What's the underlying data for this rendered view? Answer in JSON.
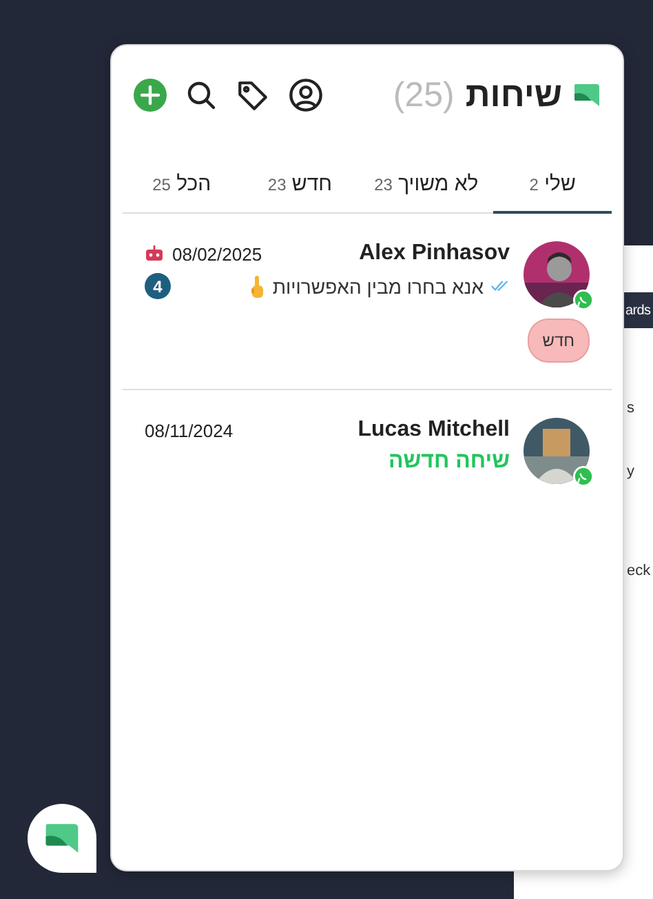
{
  "background_page": {
    "fragments": [
      "ards",
      "s",
      "y",
      "eck"
    ]
  },
  "header": {
    "title": "שיחות",
    "count": "(25)"
  },
  "tabs": [
    {
      "label": "שלי",
      "count": "2",
      "selected": true
    },
    {
      "label": "לא משויך",
      "count": "23",
      "selected": false
    },
    {
      "label": "חדש",
      "count": "23",
      "selected": false
    },
    {
      "label": "הכל",
      "count": "25",
      "selected": false
    }
  ],
  "conversations": [
    {
      "name": "Alex Pinhasov",
      "date": "08/02/2025",
      "bot": true,
      "kind": "message",
      "preview": "אנא בחרו מבין האפשרויות",
      "read": true,
      "pointing_hand": true,
      "unread_count": "4",
      "tags": [
        {
          "label": "חדש",
          "color": "#f7b9b9"
        }
      ],
      "whatsapp": true
    },
    {
      "name": "Lucas Mitchell",
      "date": "08/11/2024",
      "bot": false,
      "kind": "new",
      "preview": "שיחה חדשה",
      "whatsapp": true
    }
  ]
}
